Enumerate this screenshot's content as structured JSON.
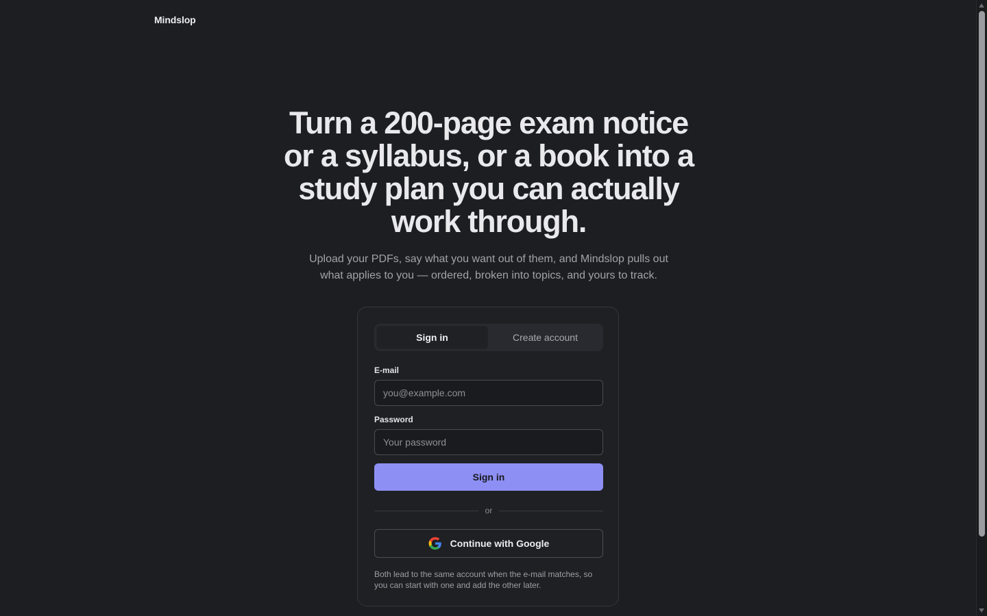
{
  "app": {
    "brand": "Mindslop"
  },
  "hero": {
    "title": "Turn a 200-page exam notice or a syllabus, or a book into a study plan you can actually work through.",
    "subtitle": "Upload your PDFs, say what you want out of them, and Mindslop pulls out what applies to you — ordered, broken into topics, and yours to track."
  },
  "auth": {
    "tabs": [
      {
        "label": "Sign in",
        "active": true
      },
      {
        "label": "Create account",
        "active": false
      }
    ],
    "email": {
      "label": "E-mail",
      "placeholder": "you@example.com",
      "value": ""
    },
    "password": {
      "label": "Password",
      "placeholder": "Your password",
      "value": ""
    },
    "submit_label": "Sign in",
    "divider": "or",
    "google_label": "Continue with Google",
    "helper": "Both lead to the same account when the e-mail matches, so you can start with one and add the other later."
  },
  "icons": {
    "google": "google-g-icon"
  },
  "colors": {
    "background": "#1d1e21",
    "card": "#1f2024",
    "accent": "#8e8ff4"
  }
}
